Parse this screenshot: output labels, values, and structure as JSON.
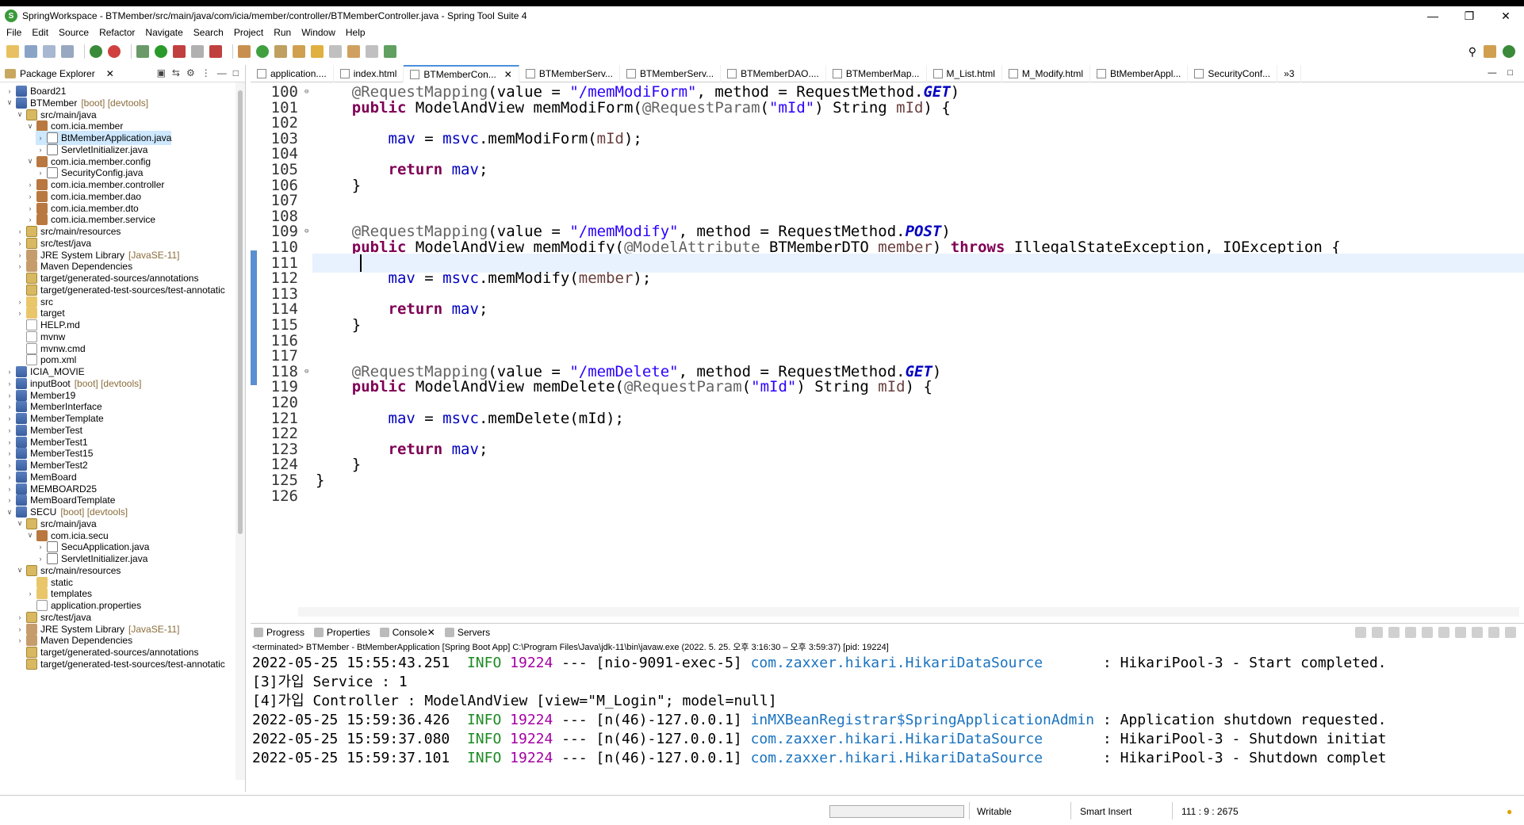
{
  "window": {
    "title": "SpringWorkspace - BTMember/src/main/java/com/icia/member/controller/BTMemberController.java - Spring Tool Suite 4"
  },
  "menu": [
    "File",
    "Edit",
    "Source",
    "Refactor",
    "Navigate",
    "Search",
    "Project",
    "Run",
    "Window",
    "Help"
  ],
  "package_explorer": {
    "title": "Package Explorer",
    "nodes": [
      {
        "arrow": ">",
        "icon": "proj",
        "label": "Board21",
        "dec": "",
        "indent": 0
      },
      {
        "arrow": "v",
        "icon": "proj",
        "label": "BTMember",
        "dec": "[boot] [devtools]",
        "indent": 0
      },
      {
        "arrow": "v",
        "icon": "src",
        "label": "src/main/java",
        "dec": "",
        "indent": 1
      },
      {
        "arrow": "v",
        "icon": "pkg",
        "label": "com.icia.member",
        "dec": "",
        "indent": 2
      },
      {
        "arrow": ">",
        "icon": "java",
        "label": "BtMemberApplication.java",
        "dec": "",
        "indent": 3,
        "selected": true
      },
      {
        "arrow": ">",
        "icon": "java",
        "label": "ServletInitializer.java",
        "dec": "",
        "indent": 3
      },
      {
        "arrow": "v",
        "icon": "pkg",
        "label": "com.icia.member.config",
        "dec": "",
        "indent": 2
      },
      {
        "arrow": ">",
        "icon": "java",
        "label": "SecurityConfig.java",
        "dec": "",
        "indent": 3
      },
      {
        "arrow": ">",
        "icon": "pkg",
        "label": "com.icia.member.controller",
        "dec": "",
        "indent": 2
      },
      {
        "arrow": ">",
        "icon": "pkg",
        "label": "com.icia.member.dao",
        "dec": "",
        "indent": 2
      },
      {
        "arrow": ">",
        "icon": "pkg",
        "label": "com.icia.member.dto",
        "dec": "",
        "indent": 2
      },
      {
        "arrow": ">",
        "icon": "pkg",
        "label": "com.icia.member.service",
        "dec": "",
        "indent": 2
      },
      {
        "arrow": ">",
        "icon": "src",
        "label": "src/main/resources",
        "dec": "",
        "indent": 1
      },
      {
        "arrow": ">",
        "icon": "src",
        "label": "src/test/java",
        "dec": "",
        "indent": 1
      },
      {
        "arrow": ">",
        "icon": "lib",
        "label": "JRE System Library",
        "dec": "[JavaSE-11]",
        "indent": 1
      },
      {
        "arrow": ">",
        "icon": "lib",
        "label": "Maven Dependencies",
        "dec": "",
        "indent": 1
      },
      {
        "arrow": "",
        "icon": "src",
        "label": "target/generated-sources/annotations",
        "dec": "",
        "indent": 1
      },
      {
        "arrow": "",
        "icon": "src",
        "label": "target/generated-test-sources/test-annotatic",
        "dec": "",
        "indent": 1
      },
      {
        "arrow": ">",
        "icon": "fold",
        "label": "src",
        "dec": "",
        "indent": 1
      },
      {
        "arrow": ">",
        "icon": "fold",
        "label": "target",
        "dec": "",
        "indent": 1
      },
      {
        "arrow": "",
        "icon": "file",
        "label": "HELP.md",
        "dec": "",
        "indent": 1
      },
      {
        "arrow": "",
        "icon": "file",
        "label": "mvnw",
        "dec": "",
        "indent": 1
      },
      {
        "arrow": "",
        "icon": "file",
        "label": "mvnw.cmd",
        "dec": "",
        "indent": 1
      },
      {
        "arrow": "",
        "icon": "file",
        "label": "pom.xml",
        "dec": "",
        "indent": 1
      },
      {
        "arrow": ">",
        "icon": "proj",
        "label": "ICIA_MOVIE",
        "dec": "",
        "indent": 0
      },
      {
        "arrow": ">",
        "icon": "proj",
        "label": "inputBoot",
        "dec": "[boot] [devtools]",
        "indent": 0
      },
      {
        "arrow": ">",
        "icon": "proj",
        "label": "Member19",
        "dec": "",
        "indent": 0
      },
      {
        "arrow": ">",
        "icon": "proj",
        "label": "MemberInterface",
        "dec": "",
        "indent": 0
      },
      {
        "arrow": ">",
        "icon": "proj",
        "label": "MemberTemplate",
        "dec": "",
        "indent": 0
      },
      {
        "arrow": ">",
        "icon": "proj",
        "label": "MemberTest",
        "dec": "",
        "indent": 0
      },
      {
        "arrow": ">",
        "icon": "proj",
        "label": "MemberTest1",
        "dec": "",
        "indent": 0
      },
      {
        "arrow": ">",
        "icon": "proj",
        "label": "MemberTest15",
        "dec": "",
        "indent": 0
      },
      {
        "arrow": ">",
        "icon": "proj",
        "label": "MemberTest2",
        "dec": "",
        "indent": 0
      },
      {
        "arrow": ">",
        "icon": "proj",
        "label": "MemBoard",
        "dec": "",
        "indent": 0
      },
      {
        "arrow": ">",
        "icon": "proj",
        "label": "MEMBOARD25",
        "dec": "",
        "indent": 0
      },
      {
        "arrow": ">",
        "icon": "proj",
        "label": "MemBoardTemplate",
        "dec": "",
        "indent": 0
      },
      {
        "arrow": "v",
        "icon": "proj",
        "label": "SECU",
        "dec": "[boot] [devtools]",
        "indent": 0
      },
      {
        "arrow": "v",
        "icon": "src",
        "label": "src/main/java",
        "dec": "",
        "indent": 1
      },
      {
        "arrow": "v",
        "icon": "pkg",
        "label": "com.icia.secu",
        "dec": "",
        "indent": 2
      },
      {
        "arrow": ">",
        "icon": "java",
        "label": "SecuApplication.java",
        "dec": "",
        "indent": 3
      },
      {
        "arrow": ">",
        "icon": "java",
        "label": "ServletInitializer.java",
        "dec": "",
        "indent": 3
      },
      {
        "arrow": "v",
        "icon": "src",
        "label": "src/main/resources",
        "dec": "",
        "indent": 1
      },
      {
        "arrow": "",
        "icon": "fold",
        "label": "static",
        "dec": "",
        "indent": 2
      },
      {
        "arrow": ">",
        "icon": "fold",
        "label": "templates",
        "dec": "",
        "indent": 2
      },
      {
        "arrow": "",
        "icon": "file",
        "label": "application.properties",
        "dec": "",
        "indent": 2
      },
      {
        "arrow": ">",
        "icon": "src",
        "label": "src/test/java",
        "dec": "",
        "indent": 1
      },
      {
        "arrow": ">",
        "icon": "lib",
        "label": "JRE System Library",
        "dec": "[JavaSE-11]",
        "indent": 1
      },
      {
        "arrow": ">",
        "icon": "lib",
        "label": "Maven Dependencies",
        "dec": "",
        "indent": 1
      },
      {
        "arrow": "",
        "icon": "src",
        "label": "target/generated-sources/annotations",
        "dec": "",
        "indent": 1
      },
      {
        "arrow": "",
        "icon": "src",
        "label": "target/generated-test-sources/test-annotatic",
        "dec": "",
        "indent": 1
      }
    ]
  },
  "editor_tabs": [
    {
      "label": "application....",
      "active": false
    },
    {
      "label": "index.html",
      "active": false
    },
    {
      "label": "BTMemberCon...",
      "active": true
    },
    {
      "label": "BTMemberServ...",
      "active": false
    },
    {
      "label": "BTMemberServ...",
      "active": false
    },
    {
      "label": "BTMemberDAO....",
      "active": false
    },
    {
      "label": "BTMemberMap...",
      "active": false
    },
    {
      "label": "M_List.html",
      "active": false
    },
    {
      "label": "M_Modify.html",
      "active": false
    },
    {
      "label": "BtMemberAppl...",
      "active": false
    },
    {
      "label": "SecurityConf...",
      "active": false
    },
    {
      "label": "»3",
      "active": false
    }
  ],
  "code": {
    "first_line": 100,
    "current_line": 111,
    "lines": [
      [
        {
          "t": "    "
        },
        {
          "t": "@RequestMapping",
          "c": "ann"
        },
        {
          "t": "(value = "
        },
        {
          "t": "\"/memModiForm\"",
          "c": "str"
        },
        {
          "t": ", method = RequestMethod."
        },
        {
          "t": "GET",
          "c": "it"
        },
        {
          "t": ")"
        }
      ],
      [
        {
          "t": "    "
        },
        {
          "t": "public",
          "c": "kw"
        },
        {
          "t": " ModelAndView memModiForm("
        },
        {
          "t": "@RequestParam",
          "c": "ann"
        },
        {
          "t": "("
        },
        {
          "t": "\"mId\"",
          "c": "str"
        },
        {
          "t": ") String "
        },
        {
          "t": "mId",
          "c": "param"
        },
        {
          "t": ") {"
        }
      ],
      [],
      [
        {
          "t": "        "
        },
        {
          "t": "mav",
          "c": "fld"
        },
        {
          "t": " = "
        },
        {
          "t": "msvc",
          "c": "fld"
        },
        {
          "t": ".memModiForm("
        },
        {
          "t": "mId",
          "c": "param"
        },
        {
          "t": ");"
        }
      ],
      [],
      [
        {
          "t": "        "
        },
        {
          "t": "return",
          "c": "kw"
        },
        {
          "t": " "
        },
        {
          "t": "mav",
          "c": "fld"
        },
        {
          "t": ";"
        }
      ],
      [
        {
          "t": "    }"
        }
      ],
      [],
      [],
      [
        {
          "t": "    "
        },
        {
          "t": "@RequestMapping",
          "c": "ann"
        },
        {
          "t": "(value = "
        },
        {
          "t": "\"/memModify\"",
          "c": "str"
        },
        {
          "t": ", method = RequestMethod."
        },
        {
          "t": "POST",
          "c": "it"
        },
        {
          "t": ")"
        }
      ],
      [
        {
          "t": "    "
        },
        {
          "t": "public",
          "c": "kw"
        },
        {
          "t": " ModelAndView memModify("
        },
        {
          "t": "@ModelAttribute",
          "c": "ann"
        },
        {
          "t": " BTMemberDTO "
        },
        {
          "t": "member",
          "c": "param"
        },
        {
          "t": ") "
        },
        {
          "t": "throws",
          "c": "kw"
        },
        {
          "t": " IllegalStateException, IOException {"
        }
      ],
      [
        {
          "t": "        "
        }
      ],
      [
        {
          "t": "        "
        },
        {
          "t": "mav",
          "c": "fld"
        },
        {
          "t": " = "
        },
        {
          "t": "msvc",
          "c": "fld"
        },
        {
          "t": ".memModify("
        },
        {
          "t": "member",
          "c": "param"
        },
        {
          "t": ");"
        }
      ],
      [],
      [
        {
          "t": "        "
        },
        {
          "t": "return",
          "c": "kw"
        },
        {
          "t": " "
        },
        {
          "t": "mav",
          "c": "fld"
        },
        {
          "t": ";"
        }
      ],
      [
        {
          "t": "    }"
        }
      ],
      [],
      [],
      [
        {
          "t": "    "
        },
        {
          "t": "@RequestMapping",
          "c": "ann"
        },
        {
          "t": "(value = "
        },
        {
          "t": "\"/memDelete\"",
          "c": "str"
        },
        {
          "t": ", method = RequestMethod."
        },
        {
          "t": "GET",
          "c": "it"
        },
        {
          "t": ")"
        }
      ],
      [
        {
          "t": "    "
        },
        {
          "t": "public",
          "c": "kw"
        },
        {
          "t": " ModelAndView memDelete("
        },
        {
          "t": "@RequestParam",
          "c": "ann"
        },
        {
          "t": "("
        },
        {
          "t": "\"mId\"",
          "c": "str"
        },
        {
          "t": ") String "
        },
        {
          "t": "mId",
          "c": "param"
        },
        {
          "t": ") {"
        }
      ],
      [],
      [
        {
          "t": "        "
        },
        {
          "t": "mav",
          "c": "fld"
        },
        {
          "t": " = "
        },
        {
          "t": "msvc",
          "c": "fld"
        },
        {
          "t": ".memDelete(mId);"
        }
      ],
      [],
      [
        {
          "t": "        "
        },
        {
          "t": "return",
          "c": "kw"
        },
        {
          "t": " "
        },
        {
          "t": "mav",
          "c": "fld"
        },
        {
          "t": ";"
        }
      ],
      [
        {
          "t": "    }"
        }
      ],
      [
        {
          "t": "}"
        }
      ],
      []
    ],
    "fold_lines": [
      100,
      109,
      118
    ]
  },
  "console": {
    "tabs": [
      {
        "label": "Progress",
        "active": false
      },
      {
        "label": "Properties",
        "active": false
      },
      {
        "label": "Console",
        "active": true
      },
      {
        "label": "Servers",
        "active": false
      }
    ],
    "description": "<terminated> BTMember - BtMemberApplication [Spring Boot App] C:\\Program Files\\Java\\jdk-11\\bin\\javaw.exe  (2022. 5. 25. 오후 3:16:30 – 오후 3:59:37) [pid: 19224]",
    "lines": [
      [
        {
          "t": "2022-05-25 15:55:43.251  "
        },
        {
          "t": "INFO",
          "c": "info"
        },
        {
          "t": " "
        },
        {
          "t": "19224",
          "c": "pid"
        },
        {
          "t": " --- [nio-9091-exec-5] "
        },
        {
          "t": "com.zaxxer.hikari.HikariDataSource",
          "c": "cls"
        },
        {
          "t": "       : HikariPool-3 - Start completed."
        }
      ],
      [
        {
          "t": "[3]가입 Service : 1"
        }
      ],
      [
        {
          "t": "[4]가입 Controller : ModelAndView [view=\"M_Login\"; model=null]"
        }
      ],
      [
        {
          "t": "2022-05-25 15:59:36.426  "
        },
        {
          "t": "INFO",
          "c": "info"
        },
        {
          "t": " "
        },
        {
          "t": "19224",
          "c": "pid"
        },
        {
          "t": " --- [n(46)-127.0.0.1] "
        },
        {
          "t": "inMXBeanRegistrar$SpringApplicationAdmin",
          "c": "cls"
        },
        {
          "t": " : Application shutdown requested."
        }
      ],
      [
        {
          "t": "2022-05-25 15:59:37.080  "
        },
        {
          "t": "INFO",
          "c": "info"
        },
        {
          "t": " "
        },
        {
          "t": "19224",
          "c": "pid"
        },
        {
          "t": " --- [n(46)-127.0.0.1] "
        },
        {
          "t": "com.zaxxer.hikari.HikariDataSource",
          "c": "cls"
        },
        {
          "t": "       : HikariPool-3 - Shutdown initiat"
        }
      ],
      [
        {
          "t": "2022-05-25 15:59:37.101  "
        },
        {
          "t": "INFO",
          "c": "info"
        },
        {
          "t": " "
        },
        {
          "t": "19224",
          "c": "pid"
        },
        {
          "t": " --- [n(46)-127.0.0.1] "
        },
        {
          "t": "com.zaxxer.hikari.HikariDataSource",
          "c": "cls"
        },
        {
          "t": "       : HikariPool-3 - Shutdown complet"
        }
      ]
    ]
  },
  "status": {
    "writable": "Writable",
    "insert_mode": "Smart Insert",
    "position": "111 : 9 : 2675"
  },
  "colors": {
    "keyword": "#7f0055",
    "string": "#2a00ff",
    "field": "#0000c0",
    "annotation": "#646464",
    "info": "#1c8a22",
    "pid": "#a400a4",
    "class": "#1a73c0"
  }
}
